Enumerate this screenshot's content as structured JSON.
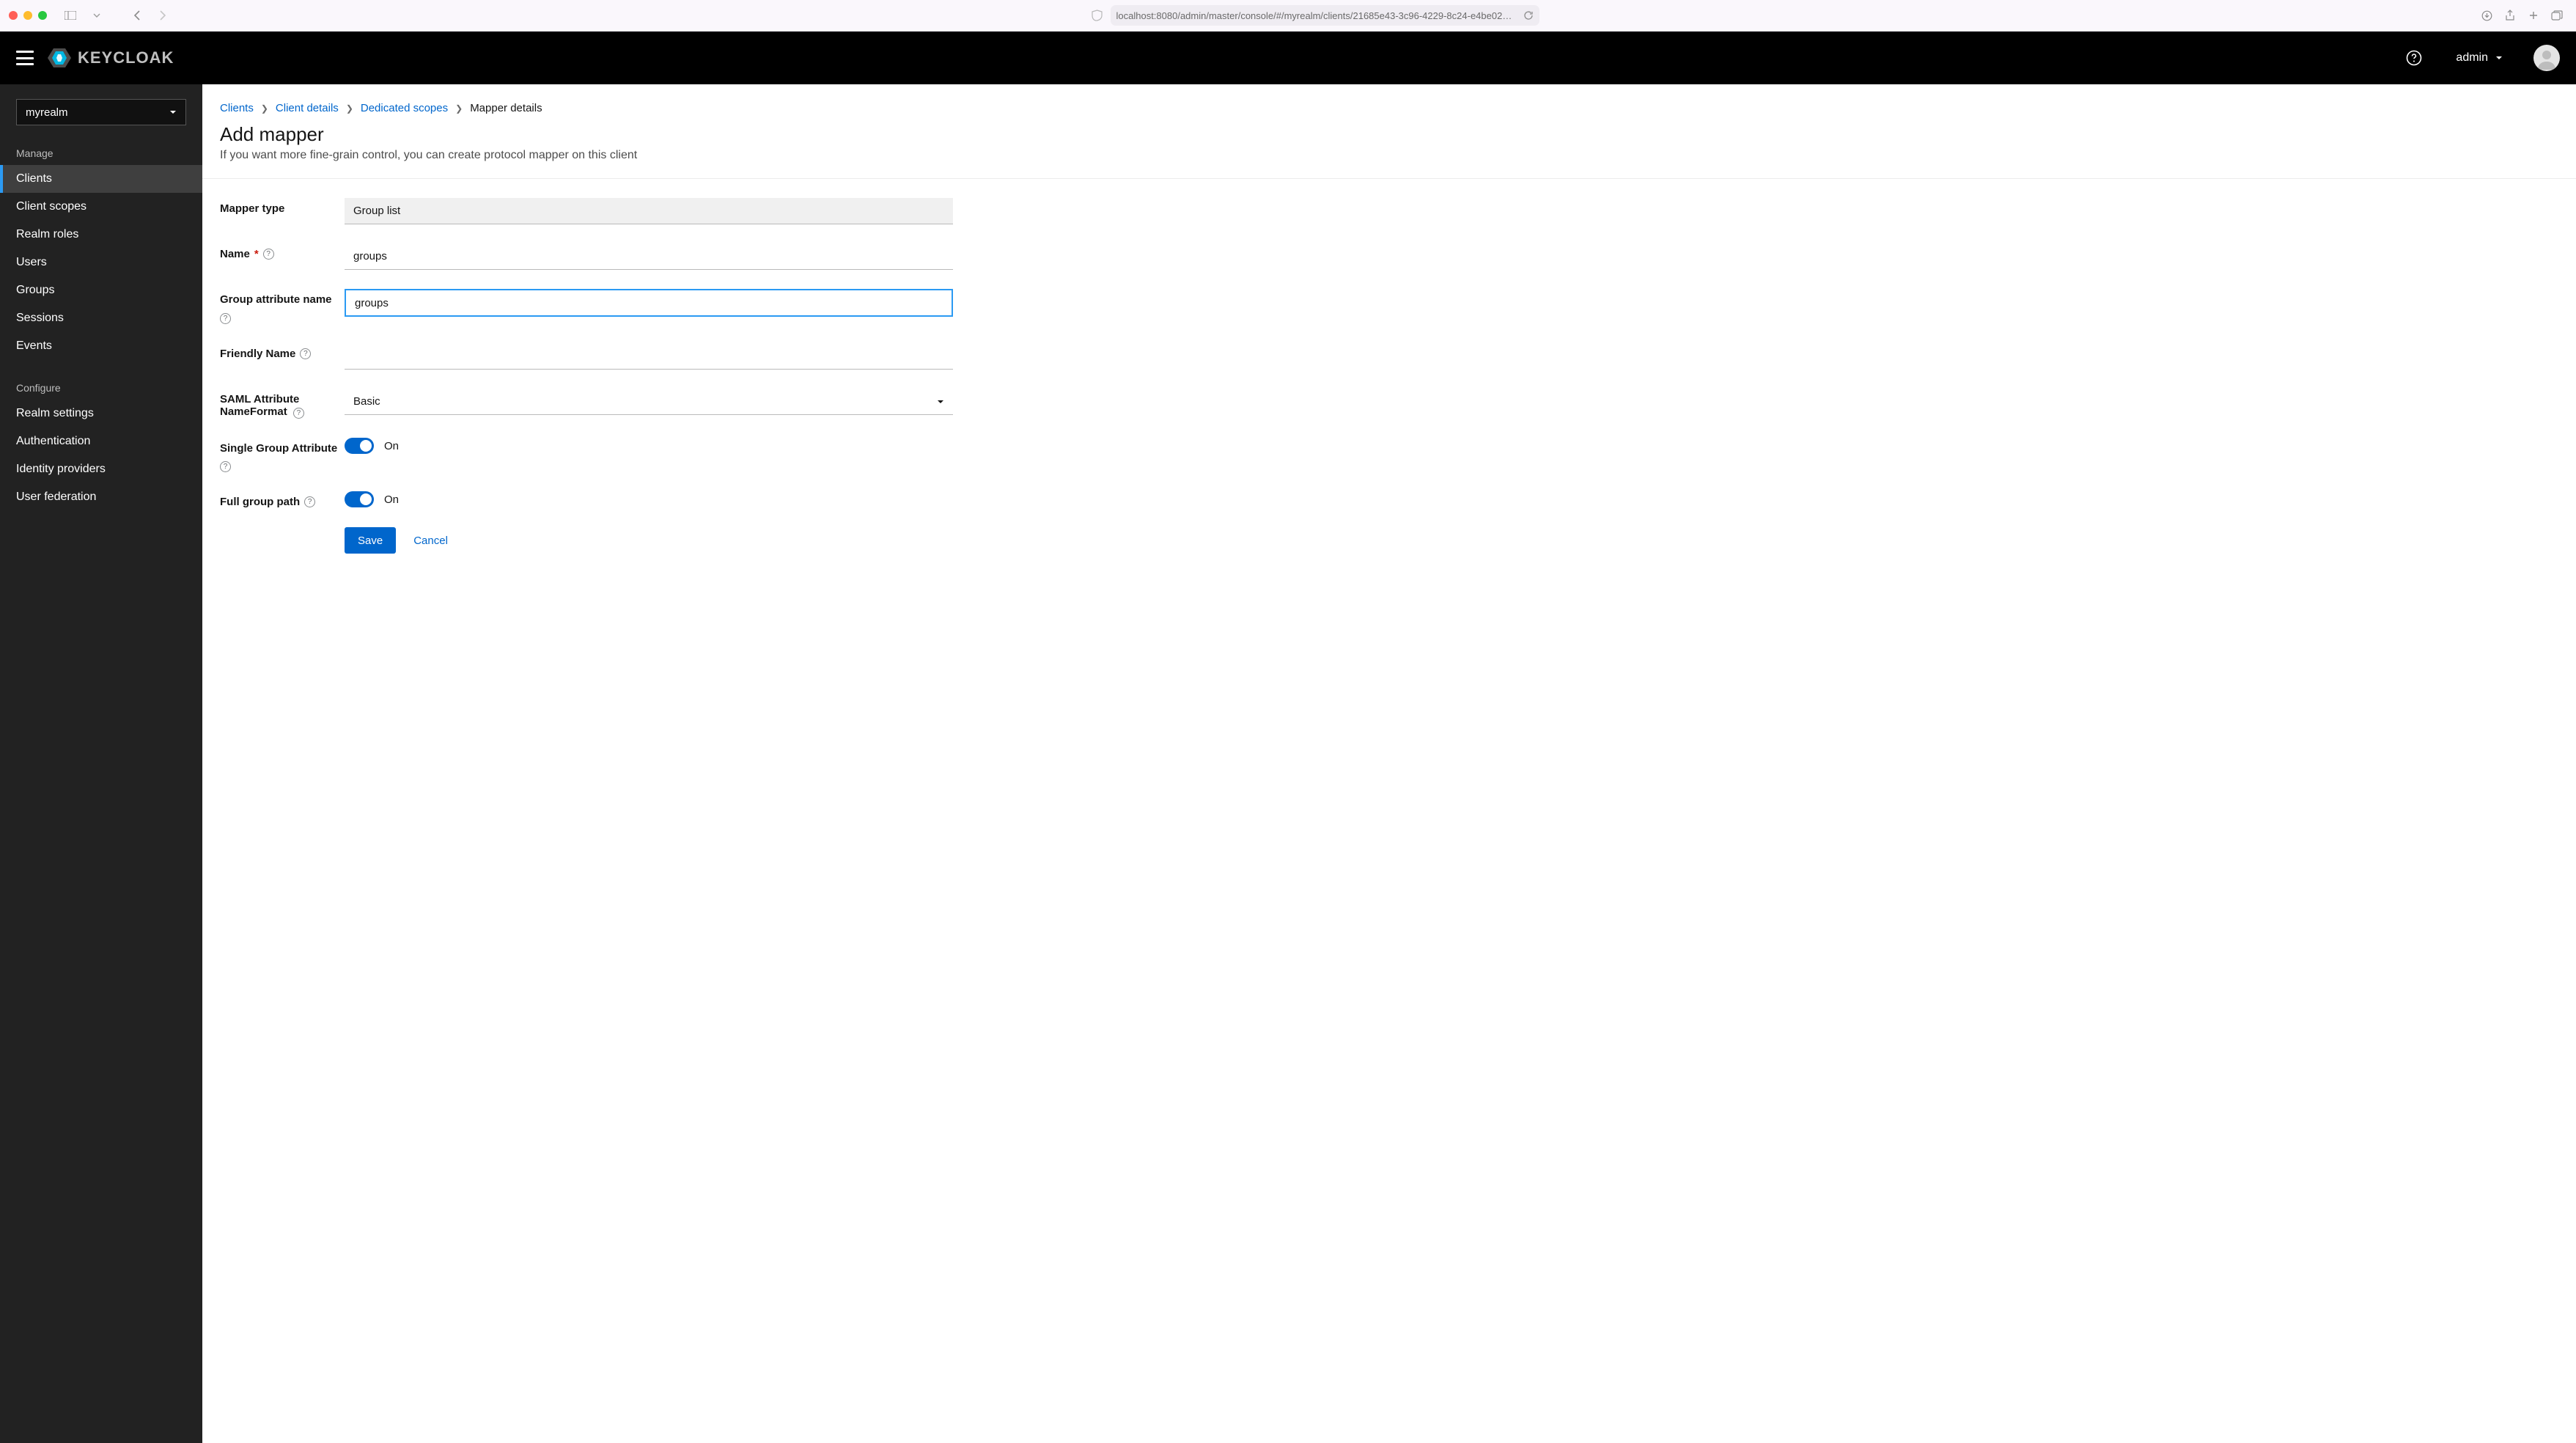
{
  "browser": {
    "url": "localhost:8080/admin/master/console/#/myrealm/clients/21685e43-3c96-4229-8c24-e4be02d67ac8/clien"
  },
  "header": {
    "brand": "KEYCLOAK",
    "user_label": "admin"
  },
  "sidebar": {
    "realm": "myrealm",
    "section_manage": "Manage",
    "section_configure": "Configure",
    "manage_items": [
      {
        "label": "Clients",
        "active": true
      },
      {
        "label": "Client scopes",
        "active": false
      },
      {
        "label": "Realm roles",
        "active": false
      },
      {
        "label": "Users",
        "active": false
      },
      {
        "label": "Groups",
        "active": false
      },
      {
        "label": "Sessions",
        "active": false
      },
      {
        "label": "Events",
        "active": false
      }
    ],
    "configure_items": [
      {
        "label": "Realm settings"
      },
      {
        "label": "Authentication"
      },
      {
        "label": "Identity providers"
      },
      {
        "label": "User federation"
      }
    ]
  },
  "breadcrumb": {
    "items": [
      {
        "label": "Clients"
      },
      {
        "label": "Client details"
      },
      {
        "label": "Dedicated scopes"
      }
    ],
    "current": "Mapper details"
  },
  "page": {
    "title": "Add mapper",
    "subtitle": "If you want more fine-grain control, you can create protocol mapper on this client"
  },
  "form": {
    "mapper_type_label": "Mapper type",
    "mapper_type_value": "Group list",
    "name_label": "Name",
    "name_value": "groups",
    "group_attr_label": "Group attribute name",
    "group_attr_value": "groups",
    "friendly_label": "Friendly Name",
    "friendly_value": "",
    "saml_fmt_label": "SAML Attribute NameFormat",
    "saml_fmt_value": "Basic",
    "single_group_label": "Single Group Attribute",
    "full_path_label": "Full group path",
    "switch_on": "On",
    "save": "Save",
    "cancel": "Cancel"
  }
}
